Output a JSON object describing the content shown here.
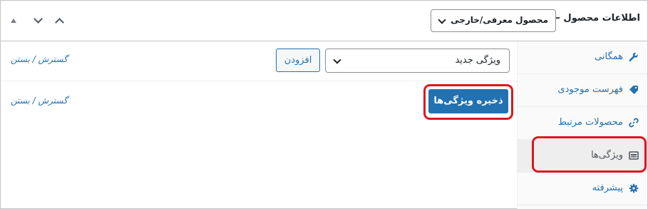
{
  "header": {
    "title": "اطلاعات محصول —",
    "product_type": "محصول معرفی/خارجی"
  },
  "sidebar": {
    "items": [
      {
        "label": "همگانی",
        "icon": "wrench-icon"
      },
      {
        "label": "فهرست موجودی",
        "icon": "tag-icon"
      },
      {
        "label": "محصولات مرتبط",
        "icon": "link-icon"
      },
      {
        "label": "ویژگی‌ها",
        "icon": "list-view-icon",
        "active": true
      },
      {
        "label": "پیشرفته",
        "icon": "gear-icon"
      }
    ]
  },
  "attributes": {
    "select_value": "ویژگی جدید",
    "add_label": "افزودن",
    "expand_collapse": "گسترش / بستن",
    "save_label": "ذخیره ویژگی‌ها"
  },
  "colors": {
    "accent": "#2271b1",
    "highlight": "#e0151e"
  }
}
